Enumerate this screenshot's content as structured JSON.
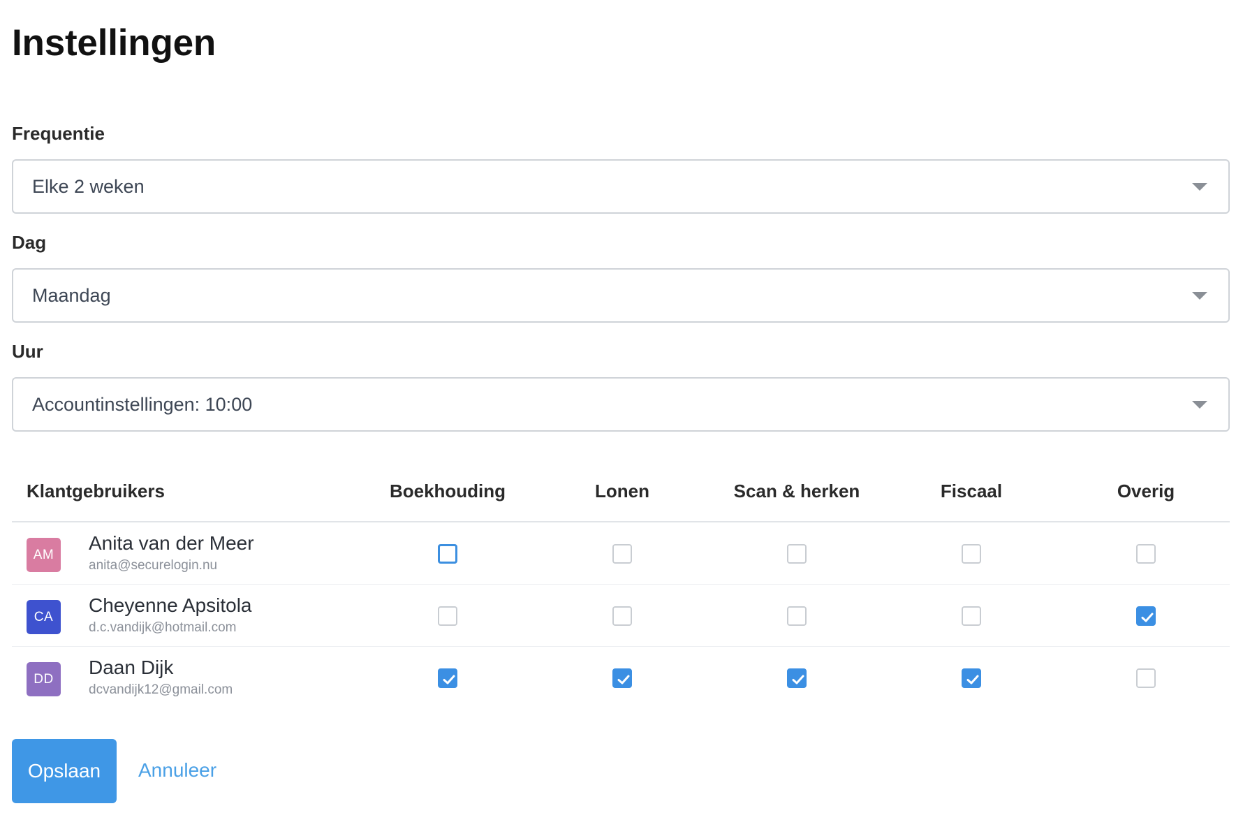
{
  "page": {
    "title": "Instellingen"
  },
  "form": {
    "frequency": {
      "label": "Frequentie",
      "value": "Elke 2 weken"
    },
    "day": {
      "label": "Dag",
      "value": "Maandag"
    },
    "hour": {
      "label": "Uur",
      "value": "Accountinstellingen: 10:00"
    }
  },
  "table": {
    "columns": [
      "Klantgebruikers",
      "Boekhouding",
      "Lonen",
      "Scan & herken",
      "Fiscaal",
      "Overig"
    ],
    "rows": [
      {
        "initials": "AM",
        "avatar_color": "#d97ca1",
        "name": "Anita van der Meer",
        "email": "anita@securelogin.nu",
        "checks": [
          false,
          false,
          false,
          false,
          false
        ]
      },
      {
        "initials": "CA",
        "avatar_color": "#3e52cf",
        "name": "Cheyenne Apsitola",
        "email": "d.c.vandijk@hotmail.com",
        "checks": [
          false,
          false,
          false,
          false,
          true
        ]
      },
      {
        "initials": "DD",
        "avatar_color": "#8e6fc1",
        "name": "Daan Dijk",
        "email": "dcvandijk12@gmail.com",
        "checks": [
          true,
          true,
          true,
          true,
          false
        ]
      }
    ]
  },
  "actions": {
    "save_label": "Opslaan",
    "cancel_label": "Annuleer"
  },
  "colors": {
    "primary": "#3f97e6",
    "checkbox_checked": "#3b8fe3",
    "link": "#4aa0e6"
  }
}
